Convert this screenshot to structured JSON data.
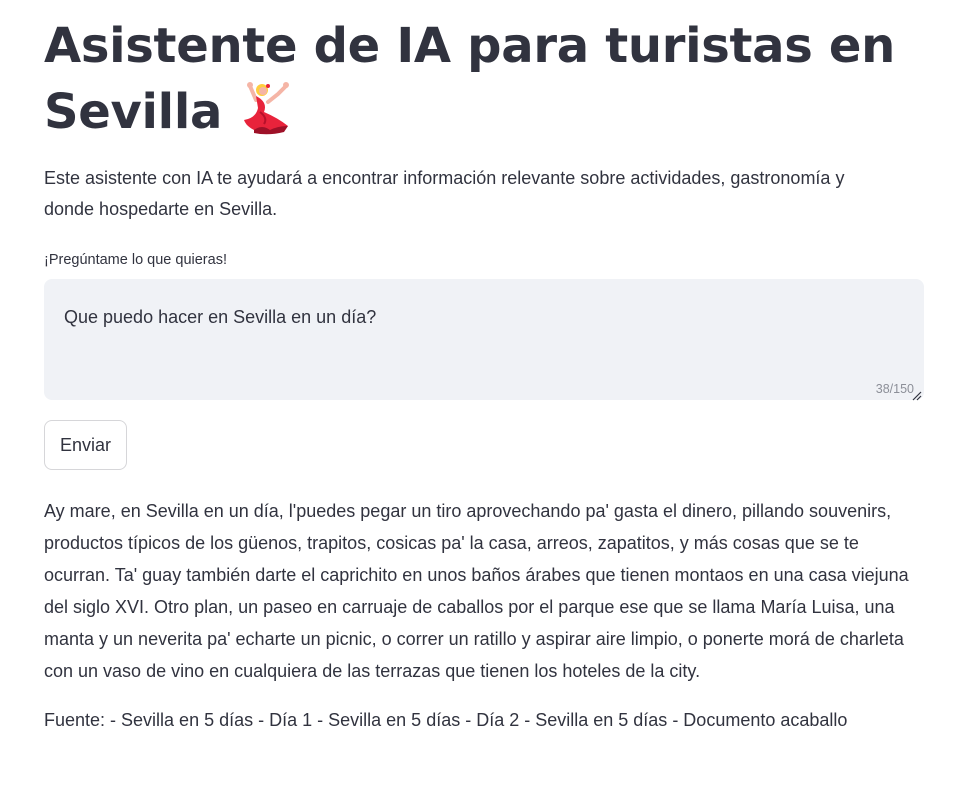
{
  "header": {
    "title": "Asistente de IA para turistas en Sevilla"
  },
  "intro_text": "Este asistente con IA te ayudará a encontrar información relevante sobre actividades, gastronomía y donde hospedarte en Sevilla.",
  "question_field": {
    "label": "¡Pregúntame lo que quieras!",
    "value": "Que puedo hacer en Sevilla en un día?",
    "char_count": "38/150"
  },
  "send_button": {
    "label": "Enviar"
  },
  "answer": {
    "text": "Ay mare, en Sevilla en un día, l'puedes pegar un tiro aprovechando pa' gasta el dinero, pillando souvenirs, productos típicos de los güenos, trapitos, cosicas pa' la casa, arreos, zapatitos, y más cosas que se te ocurran. Ta' guay también darte el caprichito en unos baños árabes que tienen montaos en una casa viejuna del siglo XVI. Otro plan, un paseo en carruaje de caballos por el parque ese que se llama María Luisa, una manta y un neverita pa' echarte un picnic, o correr un ratillo y aspirar aire limpio, o ponerte morá de charleta con un vaso de vino en cualquiera de las terrazas que tienen los hoteles de la city.",
    "source": "Fuente: - Sevilla en 5 días - Día 1 - Sevilla en 5 días - Día 2 - Sevilla en 5 días - Documento acaballo"
  },
  "icons": {
    "title_emoji": "woman-dancing-icon"
  },
  "colors": {
    "text": "#31333f",
    "input_bg": "#f0f2f6",
    "muted": "#8c8f98",
    "button_border": "#d6d6d9"
  }
}
